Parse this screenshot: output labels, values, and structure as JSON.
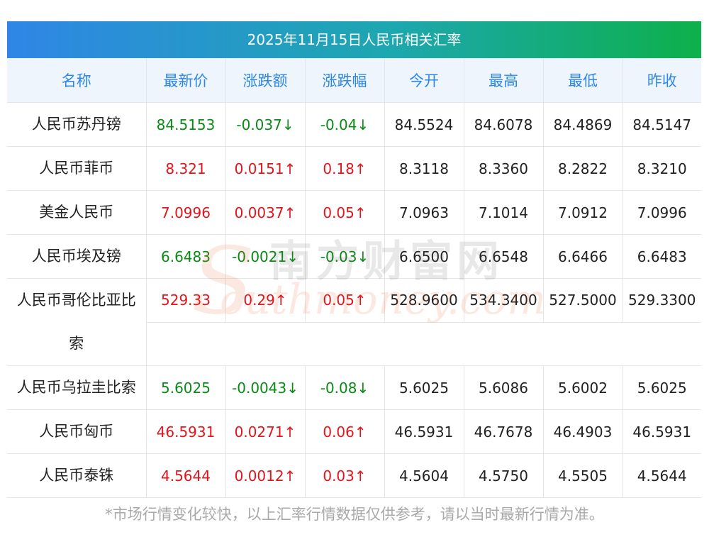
{
  "title": "2025年11月15日人民币相关汇率",
  "headers": [
    "名称",
    "最新价",
    "涨跌额",
    "涨跌幅",
    "今开",
    "最高",
    "最低",
    "昨收"
  ],
  "rows": [
    {
      "name": "人民币苏丹镑",
      "price": "84.5153",
      "change": "-0.037↓",
      "pct": "-0.04↓",
      "open": "84.5524",
      "high": "84.6078",
      "low": "84.4869",
      "prev": "84.5147",
      "dir": "down"
    },
    {
      "name": "人民币菲币",
      "price": "8.321",
      "change": "0.0151↑",
      "pct": "0.18↑",
      "open": "8.3118",
      "high": "8.3360",
      "low": "8.2822",
      "prev": "8.3210",
      "dir": "up"
    },
    {
      "name": "美金人民币",
      "price": "7.0996",
      "change": "0.0037↑",
      "pct": "0.05↑",
      "open": "7.0963",
      "high": "7.1014",
      "low": "7.0912",
      "prev": "7.0996",
      "dir": "up"
    },
    {
      "name": "人民币埃及镑",
      "price": "6.6483",
      "change": "-0.0021↓",
      "pct": "-0.03↓",
      "open": "6.6500",
      "high": "6.6548",
      "low": "6.6466",
      "prev": "6.6483",
      "dir": "down"
    },
    {
      "name": "人民币哥伦比亚比索",
      "price": "529.33",
      "change": "0.29↑",
      "pct": "0.05↑",
      "open": "528.9600",
      "high": "534.3400",
      "low": "527.5000",
      "prev": "529.3300",
      "dir": "up"
    },
    {
      "name": "人民币乌拉圭比索",
      "price": "5.6025",
      "change": "-0.0043↓",
      "pct": "-0.08↓",
      "open": "5.6025",
      "high": "5.6086",
      "low": "5.6002",
      "prev": "5.6025",
      "dir": "down"
    },
    {
      "name": "人民币匈币",
      "price": "46.5931",
      "change": "0.0271↑",
      "pct": "0.06↑",
      "open": "46.5931",
      "high": "46.7678",
      "low": "46.4903",
      "prev": "46.5931",
      "dir": "up"
    },
    {
      "name": "人民币泰铢",
      "price": "4.5644",
      "change": "0.0012↑",
      "pct": "0.03↑",
      "open": "4.5604",
      "high": "4.5750",
      "low": "4.5505",
      "prev": "4.5644",
      "dir": "up"
    }
  ],
  "note": "*市场行情变化较快，以上汇率行情数据仅供参考，请以当时最新行情为准。",
  "watermark": {
    "cn": "南方财富网",
    "en": "outhmoney.com",
    "s": "S"
  },
  "colors": {
    "up": "#e4141b",
    "down": "#0b8a17",
    "header_text": "#2f86e6"
  }
}
